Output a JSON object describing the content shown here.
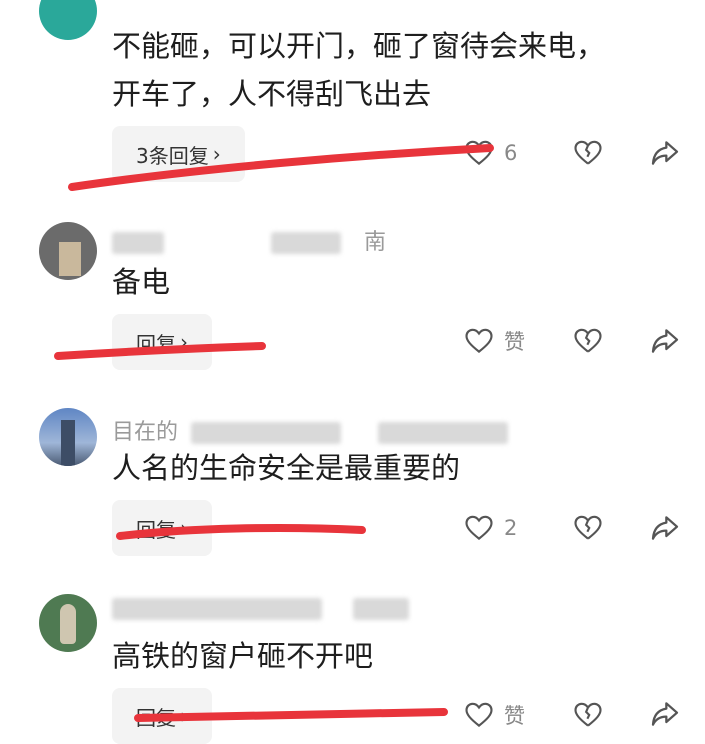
{
  "comments": [
    {
      "text_line1": "不能砸，可以开门，砸了窗待会来电，",
      "text_line2": "开车了，人不得刮飞出去",
      "reply_label": "3条回复",
      "like_count": "6"
    },
    {
      "meta_visible": "南",
      "text_line1": "备电",
      "reply_label": "回复",
      "like_count": "赞"
    },
    {
      "meta_visible": "目在的",
      "text_line1": "人名的生命安全是最重要的",
      "reply_label": "回复",
      "like_count": "2"
    },
    {
      "text_line1": "高铁的窗户砸不开吧",
      "reply_label": "回复",
      "like_count": "赞"
    }
  ],
  "colors": {
    "annotation_red": "#e8343b",
    "avatar1": "#2aa89a"
  },
  "icons": [
    "heart-icon",
    "broken-heart-icon",
    "share-arrow-icon",
    "chevron-right-icon"
  ]
}
